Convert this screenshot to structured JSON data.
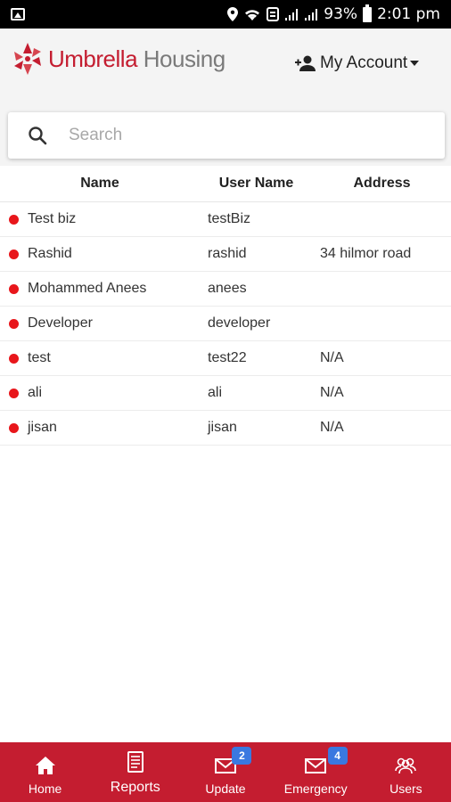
{
  "status_bar": {
    "battery": "93%",
    "time": "2:01 pm"
  },
  "header": {
    "logo_word1": "Umbrella",
    "logo_word2": "Housing",
    "account_label": "My Account"
  },
  "search": {
    "placeholder": "Search"
  },
  "table": {
    "columns": [
      "Name",
      "User Name",
      "Address"
    ],
    "rows": [
      {
        "name": "Test biz",
        "username": "testBiz",
        "address": ""
      },
      {
        "name": "Rashid",
        "username": "rashid",
        "address": "34 hilmor road"
      },
      {
        "name": "Mohammed Anees",
        "username": "anees",
        "address": ""
      },
      {
        "name": "Developer",
        "username": "developer",
        "address": ""
      },
      {
        "name": "test",
        "username": "test22",
        "address": "N/A"
      },
      {
        "name": "ali",
        "username": "ali",
        "address": "N/A"
      },
      {
        "name": "jisan",
        "username": "jisan",
        "address": "N/A"
      }
    ],
    "status_color": "#e8161b"
  },
  "bottom_nav": {
    "items": [
      {
        "label": "Home",
        "icon": "home-icon"
      },
      {
        "label": "Reports",
        "icon": "reports-icon"
      },
      {
        "label": "Update",
        "icon": "mail-icon",
        "badge": "2"
      },
      {
        "label": "Emergency",
        "icon": "mail-icon",
        "badge": "4"
      },
      {
        "label": "Users",
        "icon": "users-icon"
      }
    ],
    "background": "#c41d30",
    "badge_color": "#3a78e0"
  },
  "colors": {
    "brand_red": "#c41d30",
    "header_bg": "#f4f4f4"
  }
}
